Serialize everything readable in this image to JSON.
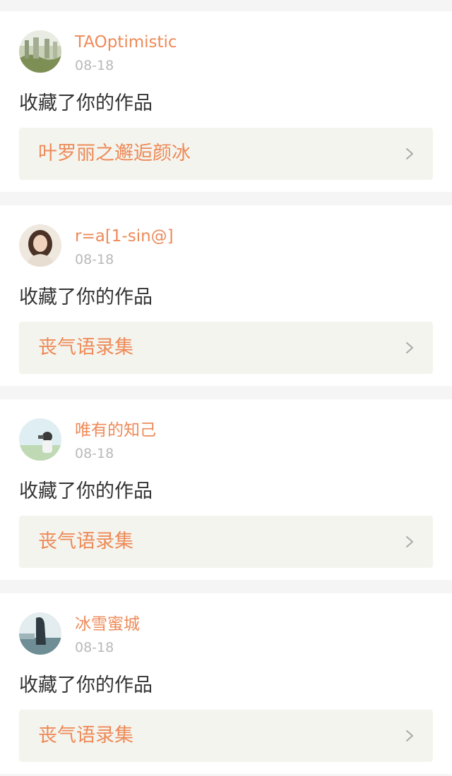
{
  "notifications": [
    {
      "username": "TAOptimistic",
      "date": "08-18",
      "action": "收藏了你的作品",
      "work_title": "叶罗丽之邂逅颜冰",
      "avatar_icon": "avatar-landscape"
    },
    {
      "username": "r=a[1-sin@]",
      "date": "08-18",
      "action": "收藏了你的作品",
      "work_title": "丧气语录集",
      "avatar_icon": "avatar-woman-portrait"
    },
    {
      "username": "唯有的知己",
      "date": "08-18",
      "action": "收藏了你的作品",
      "work_title": "丧气语录集",
      "avatar_icon": "avatar-girl-camera"
    },
    {
      "username": "冰雪蜜城",
      "date": "08-18",
      "action": "收藏了你的作品",
      "work_title": "丧气语录集",
      "avatar_icon": "avatar-silhouette"
    }
  ],
  "colors": {
    "accent": "#ee8a58",
    "date": "#b9b9b9",
    "text": "#333333",
    "link_bg": "#f4f4ee",
    "page_bg": "#f6f5f5"
  }
}
